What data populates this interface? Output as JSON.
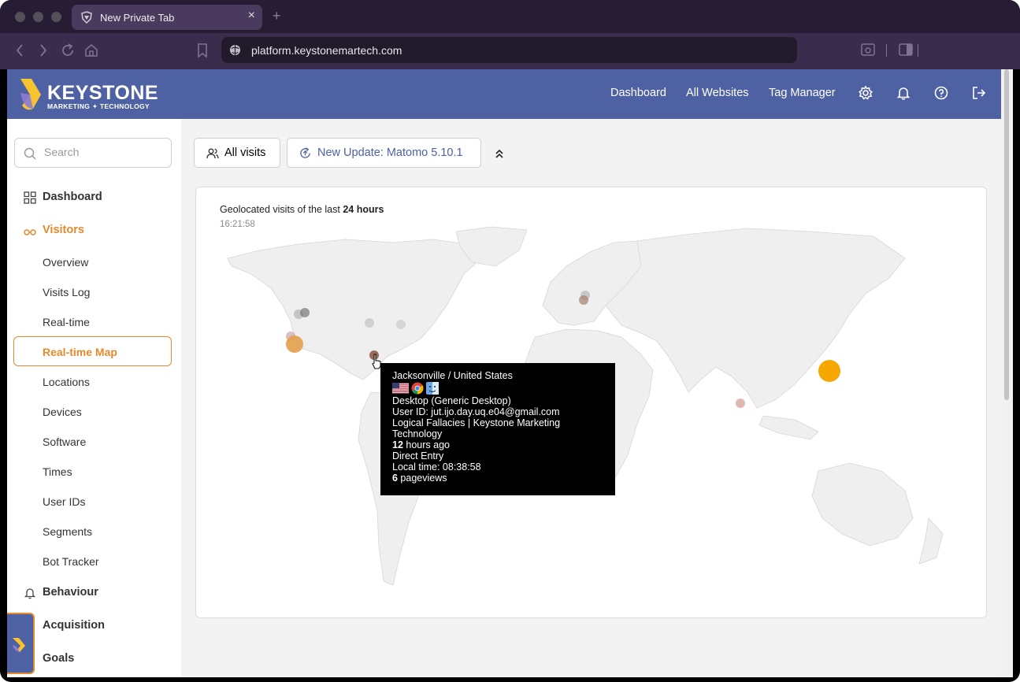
{
  "browser": {
    "tab_title": "New Private Tab",
    "url": "platform.keystonemartech.com"
  },
  "header": {
    "logo_word": "KEYSTONE",
    "logo_sub": "MARKETING ✦ TECHNOLOGY",
    "nav": [
      "Dashboard",
      "All Websites",
      "Tag Manager"
    ],
    "icons": [
      "gear-icon",
      "bell-icon",
      "help-icon",
      "logout-icon"
    ]
  },
  "sidebar": {
    "search_placeholder": "Search",
    "dashboard": "Dashboard",
    "visitors": "Visitors",
    "visitor_items": [
      "Overview",
      "Visits Log",
      "Real-time",
      "Real-time Map",
      "Locations",
      "Devices",
      "Software",
      "Times",
      "User IDs",
      "Segments",
      "Bot Tracker"
    ],
    "active_item": "Real-time Map",
    "behaviour": "Behaviour",
    "acquisition": "Acquisition",
    "goals": "Goals"
  },
  "toolbar": {
    "segment_label": "All visits",
    "update_label": "New Update: Matomo 5.10.1"
  },
  "map": {
    "title_prefix": "Geolocated visits of the last ",
    "title_bold": "24 hours",
    "time": "16:21:58",
    "colors": {
      "recent": "#f6a800",
      "old": "#999999",
      "accent": "#e38a2e"
    }
  },
  "tooltip": {
    "location": "Jacksonville / United States",
    "icons": [
      "us-flag-icon",
      "chrome-icon",
      "macos-finder-icon"
    ],
    "device": "Desktop (Generic Desktop)",
    "user_id": "User ID: jut.ijo.day.uq.e04@gmail.com",
    "page_title": "Logical Fallacies | Keystone Marketing Technology",
    "ago_num": "12",
    "ago_text": " hours ago",
    "referrer": "Direct Entry",
    "local_time": "Local time: 08:38:58",
    "pageviews_num": "6",
    "pageviews_text": " pageviews"
  }
}
